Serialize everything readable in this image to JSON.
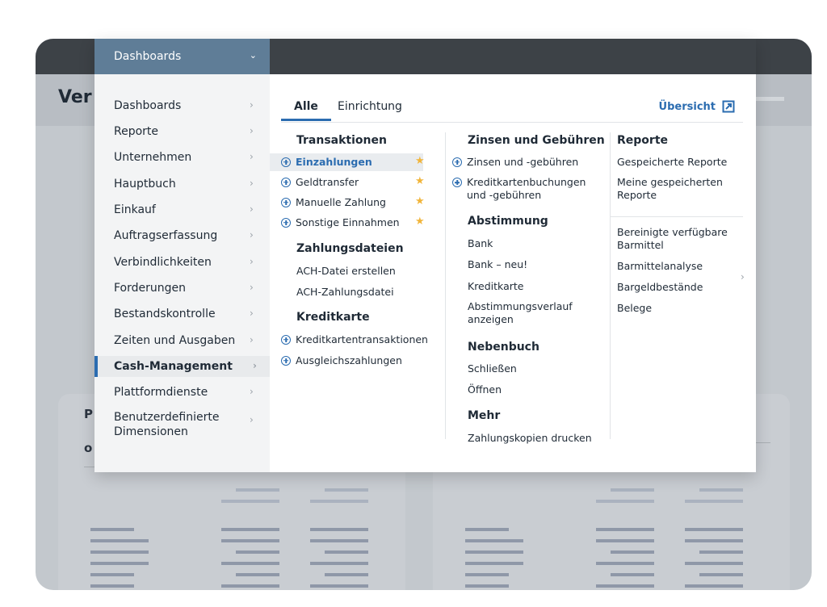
{
  "background": {
    "title": "Ver",
    "card_text_1": "P",
    "card_text_2": "o"
  },
  "nav": {
    "top_label": "Dashboards",
    "items": [
      {
        "label": "Dashboards"
      },
      {
        "label": "Reporte"
      },
      {
        "label": "Unternehmen"
      },
      {
        "label": "Hauptbuch"
      },
      {
        "label": "Einkauf"
      },
      {
        "label": "Auftragserfassung"
      },
      {
        "label": "Verbindlichkeiten"
      },
      {
        "label": "Forderungen"
      },
      {
        "label": "Bestandskontrolle"
      },
      {
        "label": "Zeiten und Ausgaben"
      },
      {
        "label": "Cash-Management"
      },
      {
        "label": "Plattformdienste"
      },
      {
        "label": "Benutzerdefinierte Dimensionen"
      }
    ]
  },
  "tabs": {
    "all": "Alle",
    "setup": "Einrichtung",
    "overview": "Übersicht"
  },
  "col1": {
    "sections": [
      {
        "title": "Transaktionen",
        "items": [
          "Einzahlungen",
          "Geldtransfer",
          "Manuelle Zahlung",
          "Sonstige Einnahmen"
        ]
      },
      {
        "title": "Zahlungsdateien",
        "items": [
          "ACH-Datei erstellen",
          "ACH-Zahlungsdatei"
        ]
      },
      {
        "title": "Kreditkarte",
        "items": [
          "Kreditkartentransaktionen",
          "Ausgleichszahlungen"
        ]
      }
    ]
  },
  "col2": {
    "sections": [
      {
        "title": "Zinsen und Gebühren",
        "items": [
          "Zinsen und -gebühren",
          "Kreditkartenbuchungen und -gebühren"
        ]
      },
      {
        "title": "Abstimmung",
        "items": [
          "Bank",
          "Bank – neu!",
          "Kreditkarte",
          "Abstimmungsverlauf anzeigen"
        ]
      },
      {
        "title": "Nebenbuch",
        "items": [
          "Schließen",
          "Öffnen"
        ]
      },
      {
        "title": "Mehr",
        "items": [
          "Zahlungskopien drucken"
        ]
      }
    ]
  },
  "col3": {
    "title": "Reporte",
    "items_top": [
      "Gespeicherte Reporte",
      "Meine gespeicherten Reporte"
    ],
    "items_bottom": [
      "Bereinigte verfügbare Barmittel",
      "Barmittelanalyse",
      "Bargeldbestände",
      "Belege"
    ]
  },
  "colors": {
    "accent": "#2b6cb0",
    "nav_top": "#5f7d97",
    "star": "#f1b53b"
  }
}
